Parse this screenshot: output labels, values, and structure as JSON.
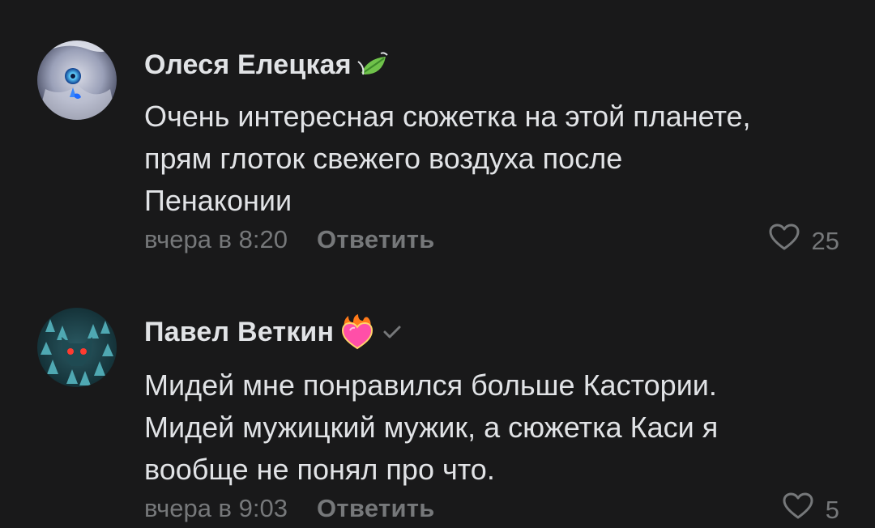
{
  "comments": [
    {
      "author": "Олеся Елецкая",
      "badge_icon": "leaf-icon",
      "text": "Очень интересная сюжетка на этой планете,\nпрям глоток свежего воздуха после\nПенаконии",
      "time": "вчера в 8:20",
      "reply_label": "Ответить",
      "likes": "25"
    },
    {
      "author": "Павел Веткин",
      "badge_icon": "flaming-heart-icon",
      "verified_icon": "checkmark-icon",
      "text": "Мидей мне понравился больше Кастории.\nМидей мужицкий мужик, а сюжетка Каси я\nвообще не понял про что.",
      "time": "вчера в 9:03",
      "reply_label": "Ответить",
      "likes": "5"
    }
  ],
  "colors": {
    "background": "#19191a",
    "text": "#e1e3e6",
    "secondary": "#76787a"
  }
}
